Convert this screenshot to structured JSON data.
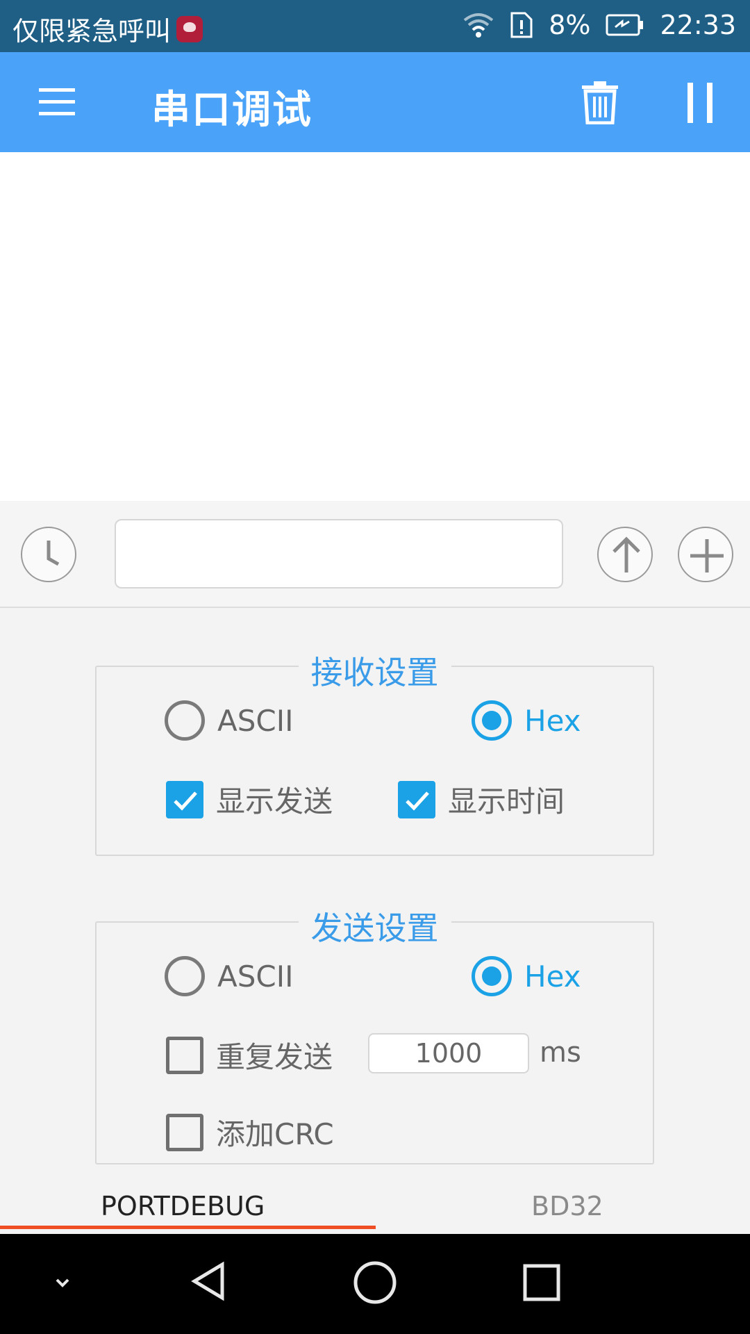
{
  "status_bar": {
    "carrier_text": "仅限紧急呼叫",
    "battery_percent": "8%",
    "time": "22:33",
    "icons": [
      "huawei-logo",
      "wifi-icon",
      "sim-alert-icon",
      "battery-charging-icon"
    ]
  },
  "app_bar": {
    "title": "串口调试",
    "background_color": "#4aa3f8",
    "icons": [
      "menu-icon",
      "trash-icon",
      "pause-icon"
    ]
  },
  "send_row": {
    "input_value": "",
    "icons": [
      "clock-icon",
      "arrow-up-icon",
      "plus-icon"
    ]
  },
  "receive_settings": {
    "title": "接收设置",
    "mode_options": [
      {
        "label": "ASCII",
        "selected": false
      },
      {
        "label": "Hex",
        "selected": true
      }
    ],
    "show_send": {
      "label": "显示发送",
      "checked": true
    },
    "show_time": {
      "label": "显示时间",
      "checked": true
    }
  },
  "send_settings": {
    "title": "发送设置",
    "mode_options": [
      {
        "label": "ASCII",
        "selected": false
      },
      {
        "label": "Hex",
        "selected": true
      }
    ],
    "repeat_send": {
      "label": "重复发送",
      "checked": false
    },
    "repeat_interval": "1000",
    "repeat_unit": "ms",
    "add_crc": {
      "label": "添加CRC",
      "checked": false
    }
  },
  "tabs": [
    {
      "label": "PORTDEBUG",
      "active": true
    },
    {
      "label": "BD32",
      "active": false
    }
  ],
  "colors": {
    "accent": "#1ba2e6",
    "tab_indicator": "#ef4e24",
    "status_bar": "#1f5f86"
  },
  "nav_bar": {
    "icons": [
      "chevron-down-icon",
      "back-icon",
      "home-icon",
      "recents-icon"
    ]
  }
}
